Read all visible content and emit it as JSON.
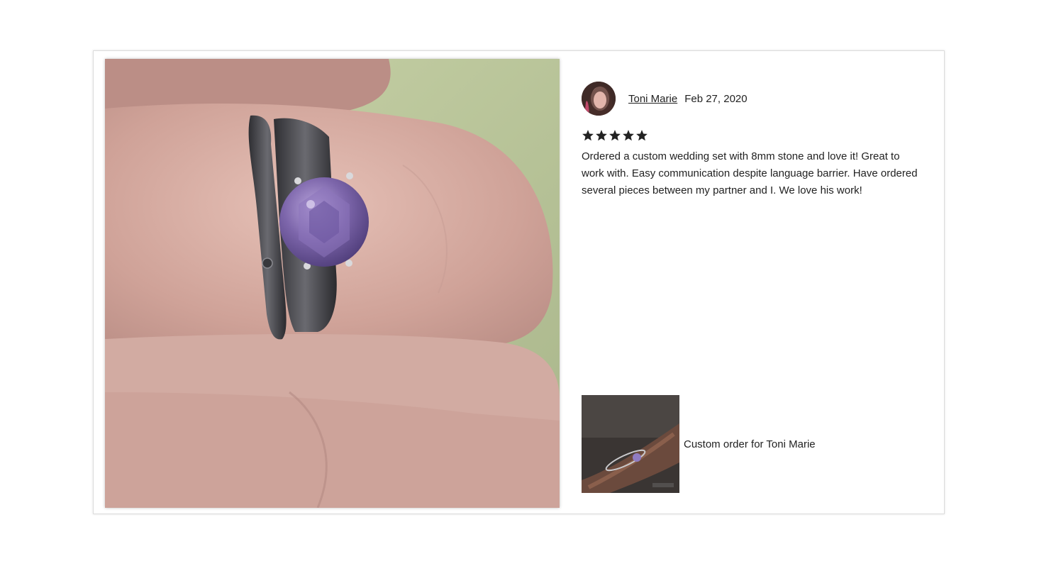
{
  "review": {
    "reviewer_name": "Toni Marie",
    "date": "Feb 27, 2020",
    "rating": 5,
    "text": "Ordered a custom wedding set with 8mm stone and love it! Great to work with. Easy communication despite language barrier. Have ordered several pieces between my partner and I. We love his work!"
  },
  "order": {
    "label": "Custom order for Toni Marie"
  },
  "icons": {
    "star": "star-icon",
    "avatar": "avatar"
  },
  "colors": {
    "text": "#222222",
    "star": "#222222",
    "stone": "#7a62a6",
    "ring": "#4a4a4a"
  }
}
